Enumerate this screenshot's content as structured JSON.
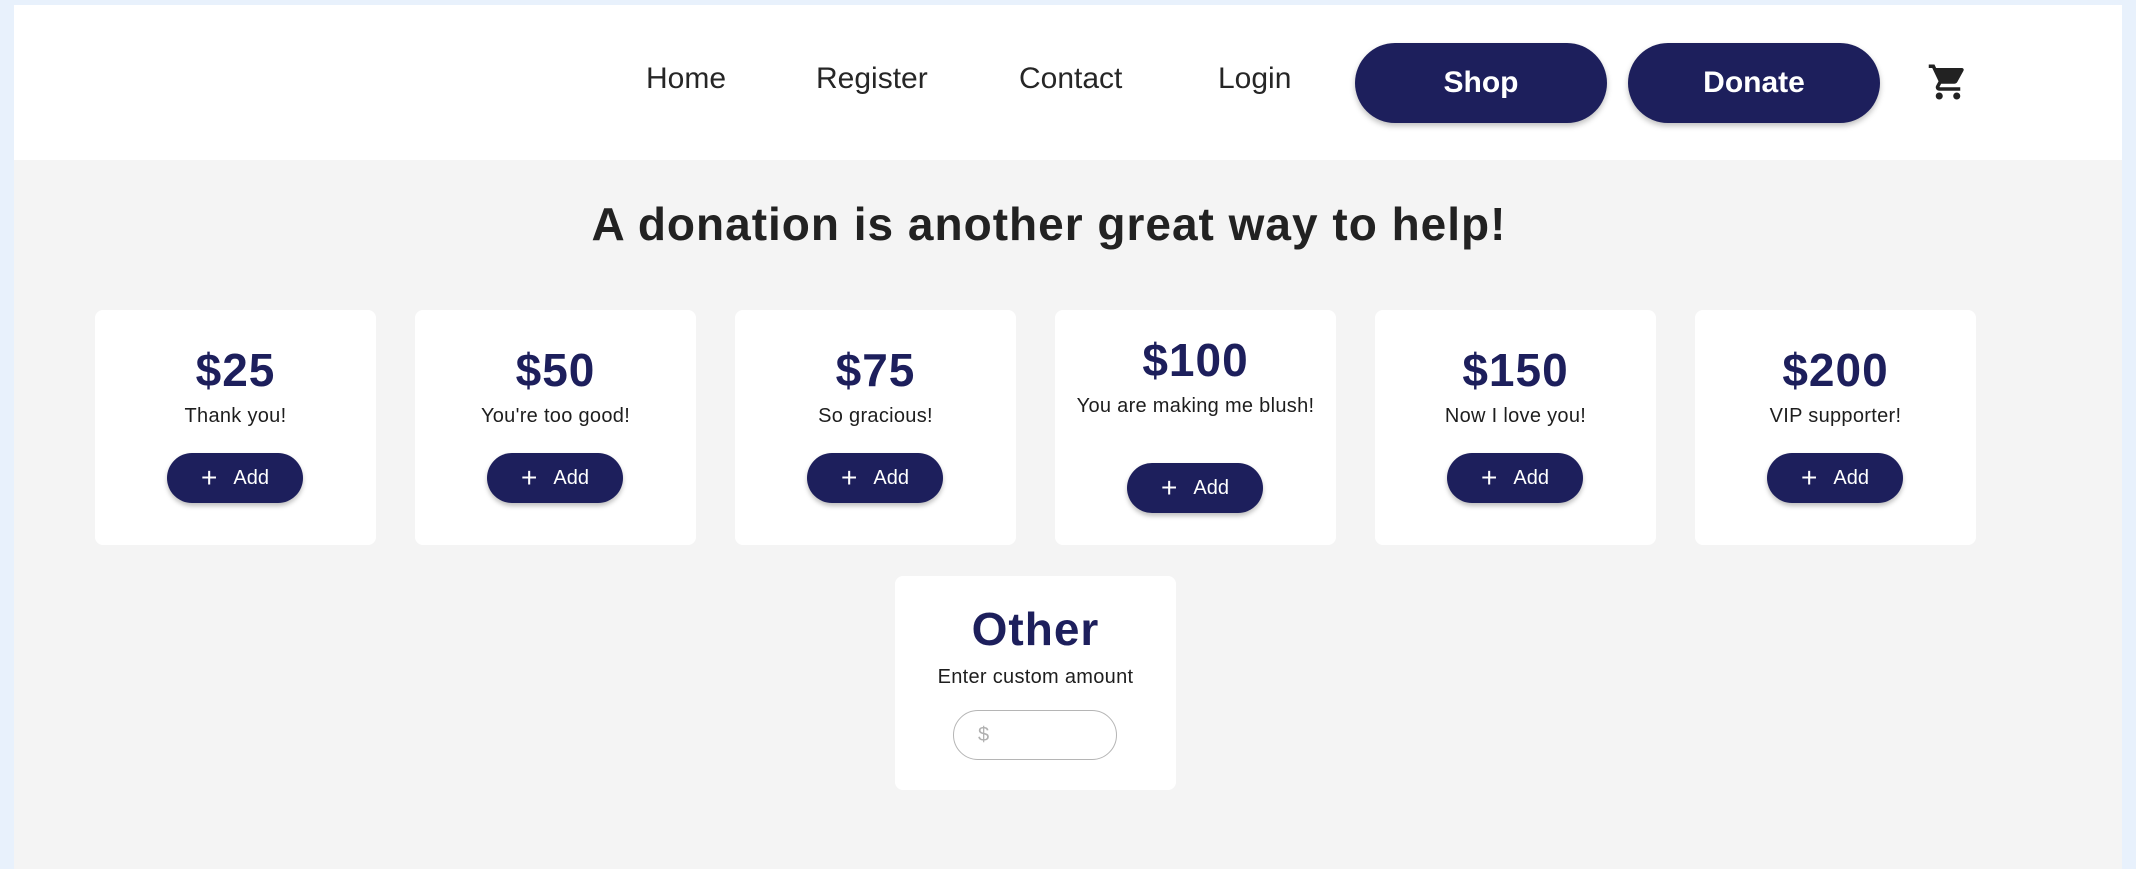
{
  "nav": {
    "links": [
      "Home",
      "Register",
      "Contact",
      "Login"
    ],
    "shop_label": "Shop",
    "donate_label": "Donate",
    "cart_icon": "cart-icon",
    "accent_color": "#1d1f5c"
  },
  "main": {
    "headline": "A donation is another great way to help!",
    "add_label": "Add",
    "add_icon": "plus-icon",
    "cards": [
      {
        "amount": "$25",
        "subtitle": "Thank you!"
      },
      {
        "amount": "$50",
        "subtitle": "You're too good!"
      },
      {
        "amount": "$75",
        "subtitle": "So gracious!"
      },
      {
        "amount": "$100",
        "subtitle": "You are making me blush!"
      },
      {
        "amount": "$150",
        "subtitle": "Now I love you!"
      },
      {
        "amount": "$200",
        "subtitle": "VIP supporter!"
      }
    ],
    "other": {
      "title": "Other",
      "subtitle": "Enter custom amount",
      "placeholder": "$",
      "value": ""
    }
  }
}
